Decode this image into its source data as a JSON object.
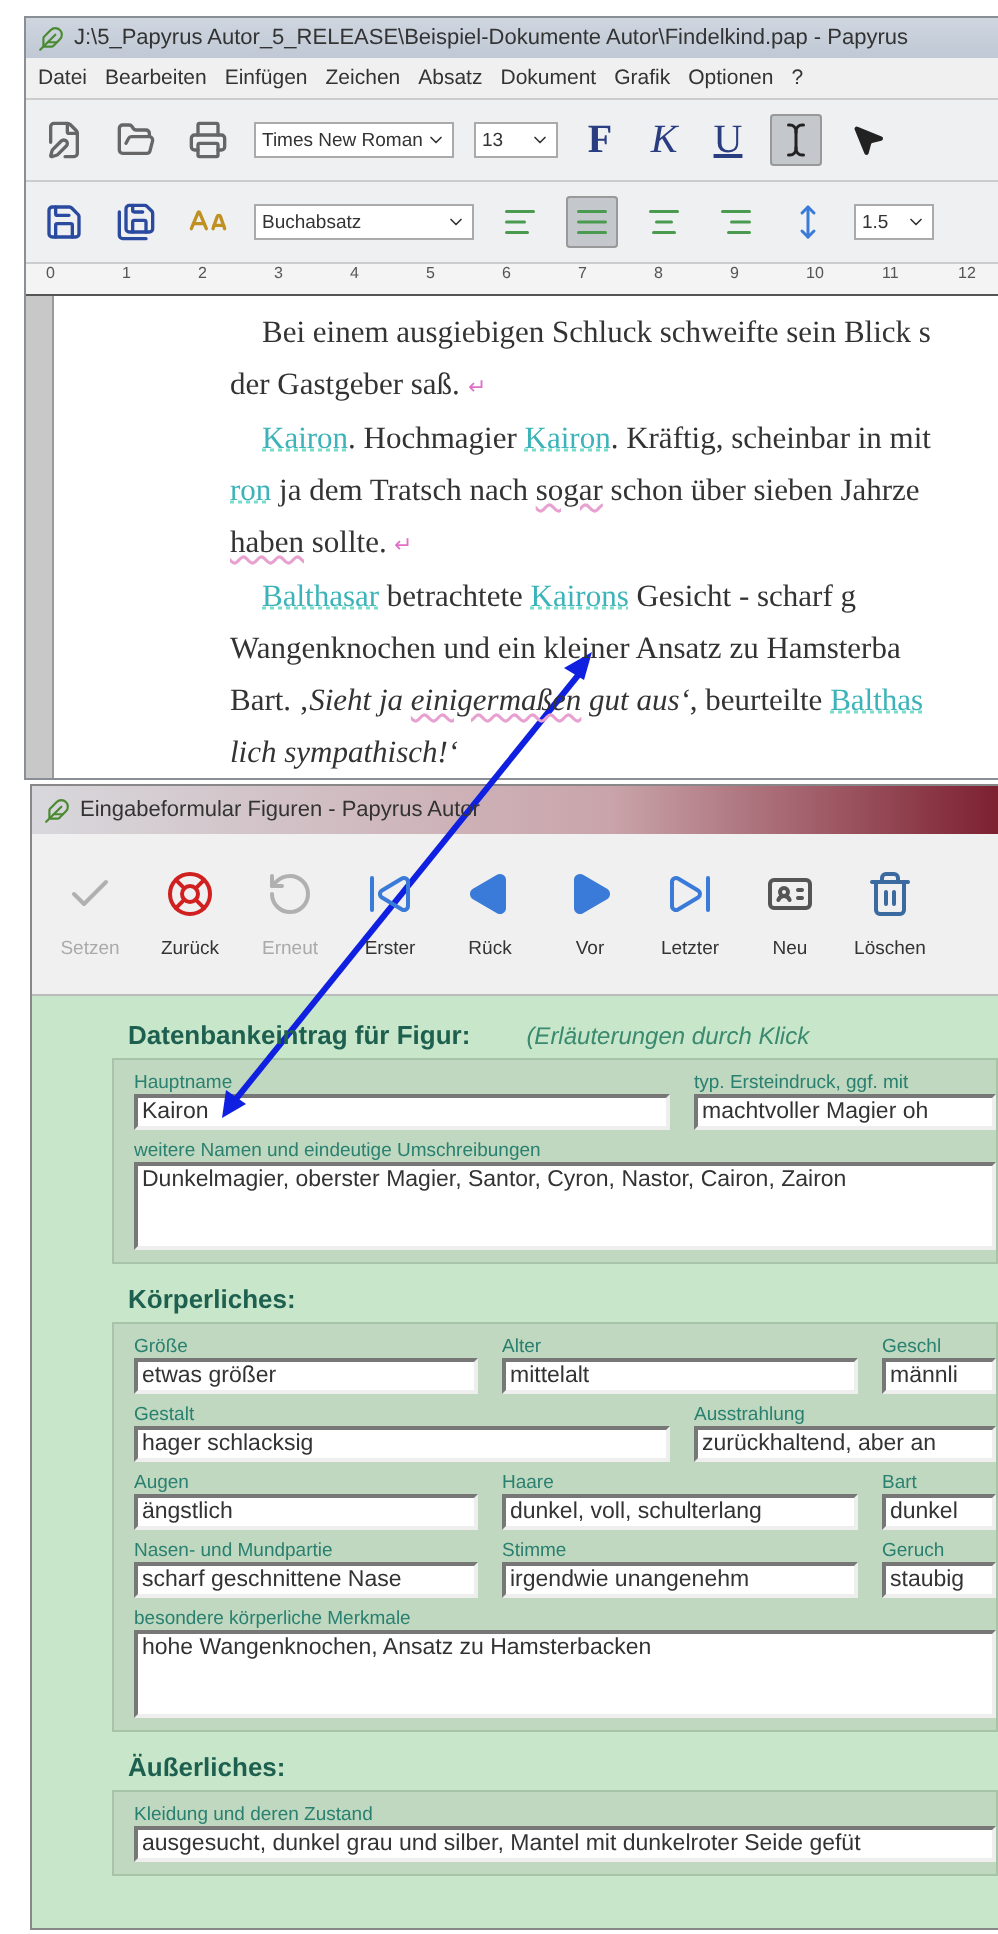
{
  "editor": {
    "title": "J:\\5_Papyrus Autor_5_RELEASE\\Beispiel-Dokumente Autor\\Findelkind.pap - Papyrus",
    "menu": [
      "Datei",
      "Bearbeiten",
      "Einfügen",
      "Zeichen",
      "Absatz",
      "Dokument",
      "Grafik",
      "Optionen",
      "?"
    ],
    "font": "Times New Roman",
    "size": "13",
    "format_buttons": [
      {
        "label": "F",
        "kind": "bold"
      },
      {
        "label": "K",
        "kind": "italic"
      },
      {
        "label": "U",
        "kind": "underline"
      }
    ],
    "tools": [
      {
        "selected": true
      },
      {
        "selected": false
      }
    ],
    "style": "Buchabsatz",
    "alignments": [
      {
        "selected": false
      },
      {
        "selected": true
      },
      {
        "selected": false
      },
      {
        "selected": false
      }
    ],
    "line_spacing": "1.5",
    "ruler": [
      "0",
      "1",
      "2",
      "3",
      "4",
      "5",
      "6",
      "7",
      "8",
      "9",
      "10",
      "11",
      "12"
    ],
    "lines": [
      {
        "indent": true,
        "segments": [
          {
            "kind": "text",
            "text": "Bei einem ausgiebigen Schluck schweifte sein Blick s"
          }
        ]
      },
      {
        "indent": false,
        "segments": [
          {
            "kind": "text",
            "text": "der Gastgeber saß. "
          },
          {
            "kind": "mark",
            "text": "↵"
          }
        ]
      },
      {
        "indent": true,
        "segments": [
          {
            "kind": "name",
            "text": "Kairon"
          },
          {
            "kind": "text",
            "text": ". Hochmagier "
          },
          {
            "kind": "name",
            "text": "Kairon"
          },
          {
            "kind": "text",
            "text": ". Kräftig, scheinbar in mit"
          }
        ]
      },
      {
        "indent": false,
        "segments": [
          {
            "kind": "name",
            "text": "ron"
          },
          {
            "kind": "text",
            "text": " ja dem Tratsch nach "
          },
          {
            "kind": "flagged",
            "text": "sogar"
          },
          {
            "kind": "text",
            "text": " schon über sieben Jahrze"
          }
        ]
      },
      {
        "indent": false,
        "segments": [
          {
            "kind": "flagged",
            "text": "haben"
          },
          {
            "kind": "text",
            "text": " sollte. "
          },
          {
            "kind": "mark",
            "text": "↵"
          }
        ]
      },
      {
        "indent": true,
        "segments": [
          {
            "kind": "name",
            "text": "Balthasar"
          },
          {
            "kind": "text",
            "text": " betrachtete "
          },
          {
            "kind": "name",
            "text": "Kairons"
          },
          {
            "kind": "text",
            "text": " Gesicht - scharf g"
          }
        ]
      },
      {
        "indent": false,
        "segments": [
          {
            "kind": "text",
            "text": "Wangenknochen und ein kleiner Ansatz zu Hamsterba"
          }
        ]
      },
      {
        "indent": false,
        "segments": [
          {
            "kind": "text",
            "text": "Bart. ‚"
          },
          {
            "kind": "italic",
            "text": "Sieht ja "
          },
          {
            "kind": "italic_flagged",
            "text": "einigermaßen"
          },
          {
            "kind": "italic",
            "text": " gut aus‘"
          },
          {
            "kind": "text",
            "text": ", beurteilte "
          },
          {
            "kind": "name",
            "text": "Balthas"
          }
        ]
      },
      {
        "indent": false,
        "segments": [
          {
            "kind": "italic",
            "text": "lich sympathisch!‘"
          }
        ]
      }
    ]
  },
  "form": {
    "title": "Eingabeformular Figuren - Papyrus Autor",
    "toolbar": [
      {
        "label": "Setzen",
        "disabled": true
      },
      {
        "label": "Zurück",
        "disabled": false
      },
      {
        "label": "Erneut",
        "disabled": true
      },
      {
        "label": "Erster",
        "disabled": false
      },
      {
        "label": "Rück",
        "disabled": false
      },
      {
        "label": "Vor",
        "disabled": false
      },
      {
        "label": "Letzter",
        "disabled": false
      },
      {
        "label": "Neu",
        "disabled": false
      },
      {
        "label": "Löschen",
        "disabled": false
      }
    ],
    "sections": [
      {
        "heading": "Datenbankeintrag für Figur:",
        "hint": "(Erläuterungen durch Klick",
        "rows": [
          [
            {
              "label": "Hauptname",
              "value": "Kairon",
              "kind": "line"
            },
            {
              "label": "typ. Ersteindruck, ggf. mit",
              "value": "machtvoller Magier oh",
              "kind": "line"
            }
          ],
          [
            {
              "label": "weitere Namen und eindeutige Umschreibungen",
              "value": "Dunkelmagier, oberster Magier, Santor, Cyron, Nastor, Cairon, Zairon",
              "kind": "area"
            }
          ]
        ]
      },
      {
        "heading": "Körperliches:",
        "rows": [
          [
            {
              "label": "Größe",
              "value": "etwas größer",
              "kind": "line"
            },
            {
              "label": "Alter",
              "value": "mittelalt",
              "kind": "line"
            },
            {
              "label": "Geschl",
              "value": "männli",
              "kind": "line"
            }
          ],
          [
            {
              "label": "Gestalt",
              "value": "hager schlacksig",
              "kind": "line"
            },
            {
              "label": "Ausstrahlung",
              "value": "zurückhaltend, aber an",
              "kind": "line"
            }
          ],
          [
            {
              "label": "Augen",
              "value": "ängstlich",
              "kind": "line"
            },
            {
              "label": "Haare",
              "value": "dunkel, voll, schulterlang",
              "kind": "line"
            },
            {
              "label": "Bart",
              "value": "dunkel",
              "kind": "line"
            }
          ],
          [
            {
              "label": "Nasen- und Mundpartie",
              "value": "scharf geschnittene Nase",
              "kind": "line"
            },
            {
              "label": "Stimme",
              "value": "irgendwie unangenehm",
              "kind": "line"
            },
            {
              "label": "Geruch",
              "value": "staubig",
              "kind": "line"
            }
          ],
          [
            {
              "label": "besondere körperliche Merkmale",
              "value": "hohe Wangenknochen, Ansatz zu Hamsterbacken",
              "kind": "area"
            }
          ]
        ]
      },
      {
        "heading": "Äußerliches:",
        "rows": [
          [
            {
              "label": "Kleidung und deren Zustand",
              "value": "ausgesucht, dunkel grau und silber, Mantel mit dunkelroter Seide gefüt",
              "kind": "line"
            }
          ]
        ]
      }
    ]
  }
}
